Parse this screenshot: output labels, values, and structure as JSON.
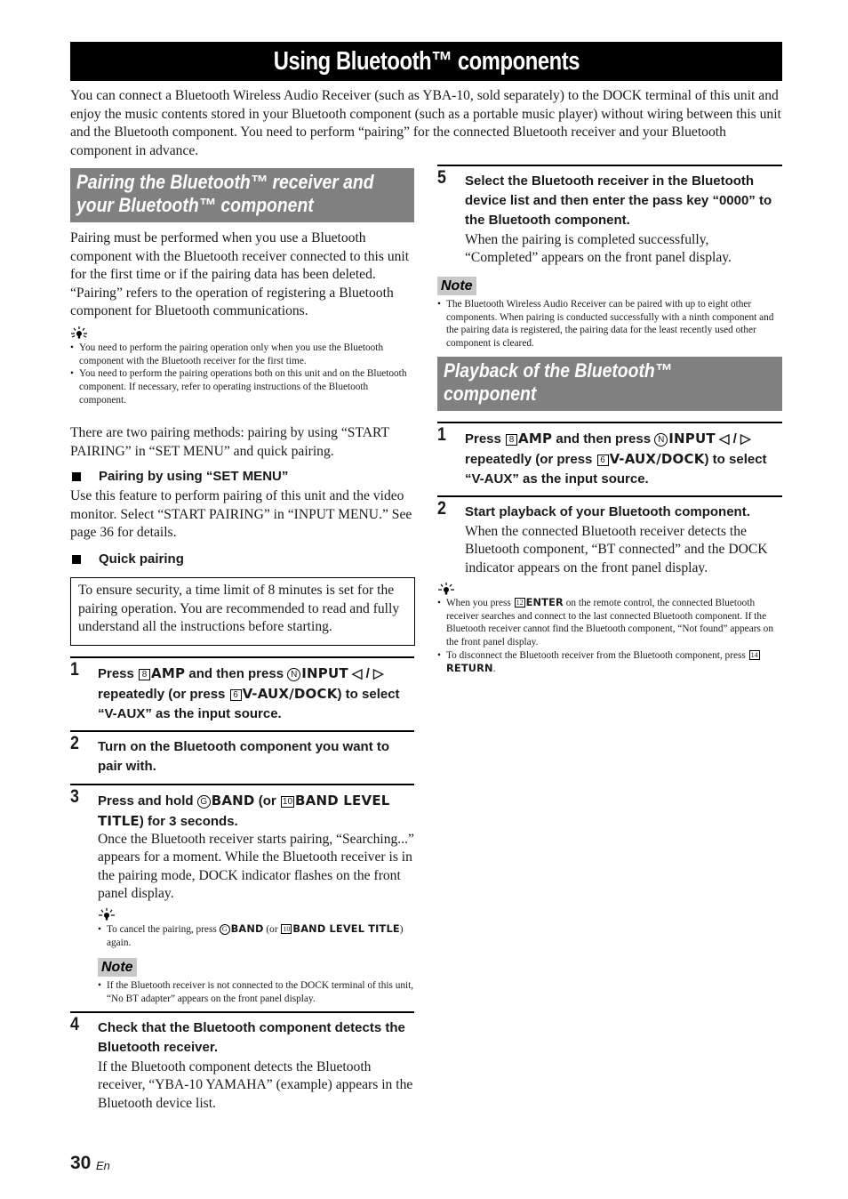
{
  "page": {
    "title": "Using Bluetooth™ components",
    "intro": "You can connect a Bluetooth Wireless Audio Receiver (such as YBA-10, sold separately) to the DOCK terminal of this unit and enjoy the music contents stored in your Bluetooth component (such as a portable music player) without wiring between this unit and the Bluetooth component. You need to perform “pairing” for the connected Bluetooth receiver and your Bluetooth component in advance.",
    "page_number": "30",
    "page_lang": "En"
  },
  "pairing": {
    "heading_line1": "Pairing the Bluetooth™ receiver and",
    "heading_line2": "your Bluetooth™ component",
    "body": "Pairing must be performed when you use a Bluetooth component with the Bluetooth receiver connected to this unit for the first time or if the pairing data has been deleted. “Pairing” refers to the operation of registering a Bluetooth component for Bluetooth communications.",
    "tip_icon": "lightbulb-tip-icon",
    "tips": [
      "You need to perform the pairing operation only when you use the Bluetooth component with the Bluetooth receiver for the first time.",
      "You need to perform the pairing operations both on this unit and on the Bluetooth component. If necessary, refer to operating instructions of the Bluetooth component."
    ],
    "methods_text": "There are two pairing methods: pairing by using “START PAIRING” in “SET MENU” and quick pairing.",
    "set_menu_heading": "Pairing by using “SET MENU”",
    "set_menu_body": "Use this feature to perform pairing of this unit and the video monitor. Select “START PAIRING” in “INPUT MENU.” See page 36 for details.",
    "quick_heading": "Quick pairing",
    "caution_box": "To ensure security, a time limit of 8 minutes is set for the pairing operation. You are recommended to read and fully understand all the instructions before starting.",
    "steps": [
      {
        "num": "1",
        "parts": {
          "a": "Press ",
          "key1": "8",
          "btn1": "AMP",
          "b": " and then press ",
          "key2": "N",
          "btn2": "INPUT",
          "c": " ◁ / ▷ repeatedly (or press ",
          "key3": "6",
          "btn3": "V-AUX/DOCK",
          "d": ") to select “V-AUX” as the input source."
        }
      },
      {
        "num": "2",
        "instruction": "Turn on the Bluetooth component you want to pair with."
      },
      {
        "num": "3",
        "parts": {
          "a": "Press and hold ",
          "key1": "G",
          "btn1": "BAND",
          "b": " (or ",
          "key2": "10",
          "btn2": "BAND LEVEL TITLE",
          "c": ") for 3 seconds."
        },
        "detail": "Once the Bluetooth receiver starts pairing, “Searching...” appears for a moment. While the Bluetooth receiver is in the pairing mode, DOCK indicator flashes on the front panel display.",
        "tip": {
          "a": "To cancel the pairing, press ",
          "key1": "G",
          "btn1": "BAND",
          "b": " (or ",
          "key2": "10",
          "btn2": "BAND LEVEL TITLE",
          "c": ") again."
        },
        "note_label": "Note",
        "note": "If the Bluetooth receiver is not connected to the DOCK terminal of this unit, “No BT adapter” appears on the front panel display."
      },
      {
        "num": "4",
        "instruction": "Check that the Bluetooth component detects the Bluetooth receiver.",
        "detail": "If the Bluetooth component detects the Bluetooth receiver, “YBA-10 YAMAHA” (example) appears in the Bluetooth device list."
      },
      {
        "num": "5",
        "instruction": "Select the Bluetooth receiver in the Bluetooth device list and then enter the pass key “0000” to the Bluetooth component.",
        "detail": "When the pairing is completed successfully, “Completed” appears on the front panel display.",
        "note_label": "Note",
        "note": "The Bluetooth Wireless Audio Receiver can be paired with up to eight other components. When pairing is conducted successfully with a ninth component and the pairing data is registered, the pairing data for the least recently used other component is cleared."
      }
    ]
  },
  "playback": {
    "heading_line1": "Playback of the Bluetooth™",
    "heading_line2": "component",
    "steps": [
      {
        "num": "1",
        "parts": {
          "a": "Press ",
          "key1": "8",
          "btn1": "AMP",
          "b": " and then press ",
          "key2": "N",
          "btn2": "INPUT",
          "c": " ◁ / ▷ repeatedly (or press ",
          "key3": "6",
          "btn3": "V-AUX/DOCK",
          "d": ") to select “V-AUX” as the input source."
        }
      },
      {
        "num": "2",
        "instruction": "Start playback of your Bluetooth component.",
        "detail": "When the connected Bluetooth receiver detects the Bluetooth component, “BT connected” and the DOCK indicator appears on the front panel display."
      }
    ],
    "tips": [
      {
        "a": "When you press ",
        "key": "12",
        "btn": "ENTER",
        "b": " on the remote control, the connected Bluetooth receiver searches and connect to the last connected Bluetooth component. If the Bluetooth receiver cannot find the Bluetooth component, “Not found” appears on the front panel display."
      },
      {
        "a": "To disconnect the Bluetooth receiver from the Bluetooth component, press ",
        "key": "14",
        "btn": "RETURN",
        "b": "."
      }
    ]
  }
}
